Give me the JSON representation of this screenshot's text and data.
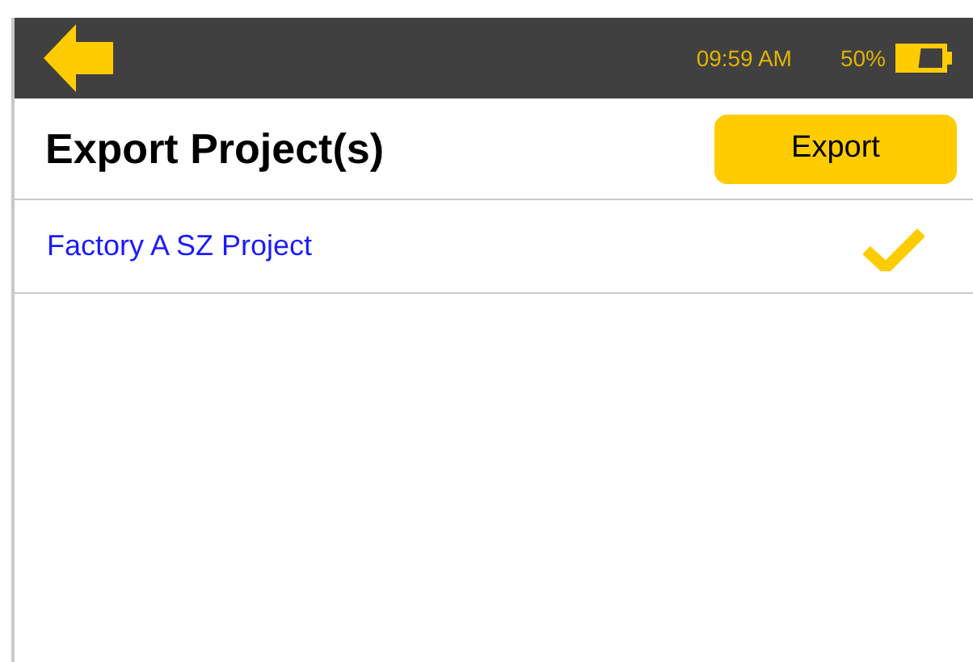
{
  "status_bar": {
    "time": "09:59 AM",
    "battery": "50%"
  },
  "header": {
    "title": "Export Project(s)",
    "button": "Export"
  },
  "projects": [
    {
      "name": "Factory A SZ Project",
      "selected": true
    }
  ]
}
